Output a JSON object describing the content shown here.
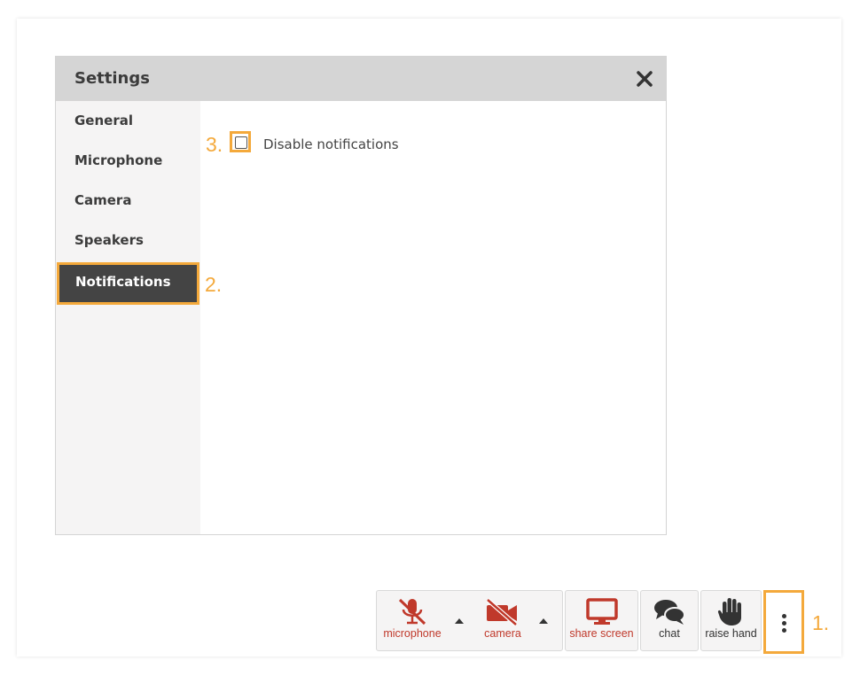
{
  "dialog": {
    "title": "Settings",
    "nav": [
      {
        "label": "General"
      },
      {
        "label": "Microphone"
      },
      {
        "label": "Camera"
      },
      {
        "label": "Speakers"
      },
      {
        "label": "Notifications",
        "active": true
      }
    ],
    "notifications": {
      "disable_label": "Disable notifications",
      "checked": false
    }
  },
  "steps": {
    "one": "1.",
    "two": "2.",
    "three": "3."
  },
  "toolbar": {
    "microphone": "microphone",
    "camera": "camera",
    "share_screen": "share screen",
    "chat": "chat",
    "raise_hand": "raise hand"
  },
  "colors": {
    "accent": "#f4a93b",
    "muted_red": "#c0392b",
    "dark": "#444444"
  }
}
